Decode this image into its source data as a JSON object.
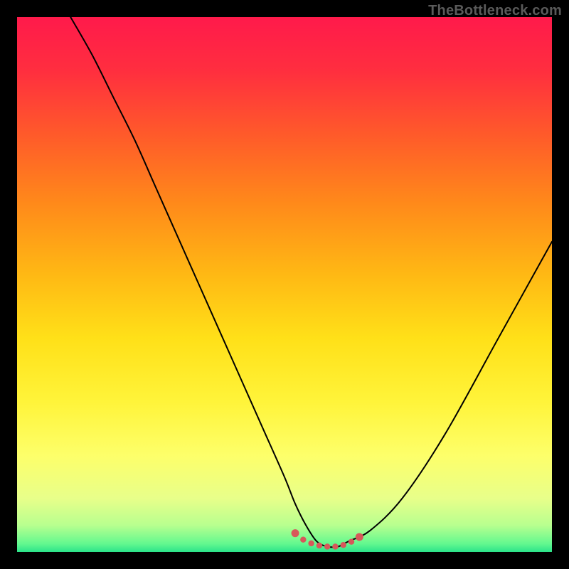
{
  "watermark": "TheBottleneck.com",
  "gradient": {
    "stops": [
      {
        "offset": 0.0,
        "color": "#ff1a4b"
      },
      {
        "offset": 0.1,
        "color": "#ff2e3f"
      },
      {
        "offset": 0.22,
        "color": "#ff5a2a"
      },
      {
        "offset": 0.35,
        "color": "#ff8a1a"
      },
      {
        "offset": 0.48,
        "color": "#ffb814"
      },
      {
        "offset": 0.6,
        "color": "#ffe018"
      },
      {
        "offset": 0.72,
        "color": "#fff43a"
      },
      {
        "offset": 0.82,
        "color": "#fdff6a"
      },
      {
        "offset": 0.9,
        "color": "#e8ff8a"
      },
      {
        "offset": 0.95,
        "color": "#b8ff8f"
      },
      {
        "offset": 0.985,
        "color": "#62f88f"
      },
      {
        "offset": 1.0,
        "color": "#2be38a"
      }
    ]
  },
  "colors": {
    "curve": "#000000",
    "marker": "#d7575a"
  },
  "chart_data": {
    "type": "line",
    "title": "",
    "xlabel": "",
    "ylabel": "",
    "xlim": [
      0,
      100
    ],
    "ylim": [
      0,
      100
    ],
    "series": [
      {
        "name": "bottleneck-curve",
        "x": [
          10,
          14,
          18,
          22,
          26,
          30,
          34,
          38,
          42,
          46,
          50,
          52,
          54,
          56,
          58,
          60,
          62,
          66,
          72,
          80,
          90,
          100
        ],
        "y": [
          100,
          93,
          85,
          77,
          68,
          59,
          50,
          41,
          32,
          23,
          14,
          9,
          5,
          2,
          1,
          1,
          2,
          4,
          10,
          22,
          40,
          58
        ]
      }
    ],
    "markers": {
      "name": "optimal-zone",
      "x": [
        52,
        53.5,
        55,
        56.5,
        58,
        59.5,
        61,
        62.5,
        64
      ],
      "y": [
        3.5,
        2.3,
        1.6,
        1.2,
        1.0,
        1.0,
        1.3,
        1.9,
        2.8
      ]
    }
  }
}
